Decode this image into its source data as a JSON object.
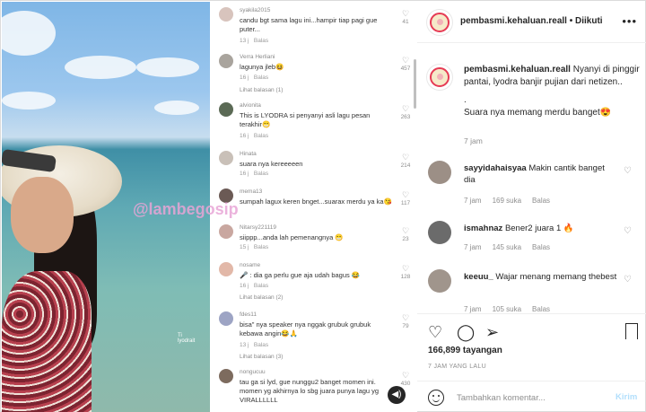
{
  "media": {
    "watermark": "@lambegosip",
    "tag_text": "Ti",
    "tag_sub": "lyodrait"
  },
  "comments": [
    {
      "user": "syakila2015",
      "text": "candu bgt sama lagu ini...hampir tiap pagi gue puter...",
      "time": "13 j",
      "reply": "Balas",
      "likes": "41",
      "thread": ""
    },
    {
      "user": "Verra Herliani",
      "text": "lagunya jleb😆",
      "time": "16 j",
      "reply": "Balas",
      "likes": "457",
      "thread": "Lihat balasan (1)"
    },
    {
      "user": "alvionita",
      "text": "This is LYODRA si penyanyi asli lagu pesan terakhir😁",
      "time": "16 j",
      "reply": "Balas",
      "likes": "263",
      "thread": ""
    },
    {
      "user": "Hinata",
      "text": "suara nya kereeeeen",
      "time": "16 j",
      "reply": "Balas",
      "likes": "214",
      "thread": ""
    },
    {
      "user": "mema13",
      "text": "sumpah lagux keren bnget...suarax merdu ya ka😘",
      "time": "16 j",
      "reply": "Balas",
      "likes": "117",
      "thread": ""
    },
    {
      "user": "Nitarsy221119",
      "text": "siippp...anda lah pemenangnya 😁",
      "time": "15 j",
      "reply": "Balas",
      "likes": "23",
      "thread": ""
    },
    {
      "user": "nosame",
      "text": "🎤 : dia ga perlu gue aja udah bagus 😂",
      "time": "16 j",
      "reply": "Balas",
      "likes": "128",
      "thread": "Lihat balasan (2)"
    },
    {
      "user": "fdes11",
      "text": "bisa\" nya speaker nya nggak grubuk grubuk kebawa angin😂🙏",
      "time": "13 j",
      "reply": "Balas",
      "likes": "79",
      "thread": "Lihat balasan (3)"
    },
    {
      "user": "nongucuu",
      "text": "tau ga si lyd, gue nunggu2 banget momen ini. momen yg akhirnya lo sbg juara punya lagu yg VIRALLLLLL",
      "time": "",
      "reply": "",
      "likes": "430",
      "thread": ""
    }
  ],
  "header": {
    "username": "pembasmi.kehaluan.reall",
    "separator": "•",
    "follow_label": "Diikuti",
    "more_label": "•••"
  },
  "caption": {
    "username": "pembasmi.kehaluan.reall",
    "line1": "Nyanyi di pinggir pantai, lyodra banjir pujian dari netizen..",
    "line2": ".",
    "line3": "Suara nya memang merdu banget😍",
    "time": "7 jam"
  },
  "post_comments": [
    {
      "user": "sayyidahaisyaa",
      "text": "Makin cantik banget dia",
      "time": "7 jam",
      "likes": "169 suka",
      "reply": "Balas"
    },
    {
      "user": "ismahnaz",
      "text": "Bener2 juara 1 🔥",
      "time": "7 jam",
      "likes": "145 suka",
      "reply": "Balas"
    },
    {
      "user": "keeuu_",
      "text": "Wajar menang memang thebest",
      "time": "7 jam",
      "likes": "105 suka",
      "reply": "Balas"
    }
  ],
  "stats": {
    "views": "166,899 tayangan",
    "ago": "7 JAM YANG LALU"
  },
  "composer": {
    "placeholder": "Tambahkan komentar...",
    "send_label": "Kirim"
  },
  "icons": {
    "like": "heart-icon",
    "comment": "comment-icon",
    "share": "share-icon",
    "save": "bookmark-icon",
    "emoji": "emoji-icon",
    "sound": "sound-icon"
  }
}
